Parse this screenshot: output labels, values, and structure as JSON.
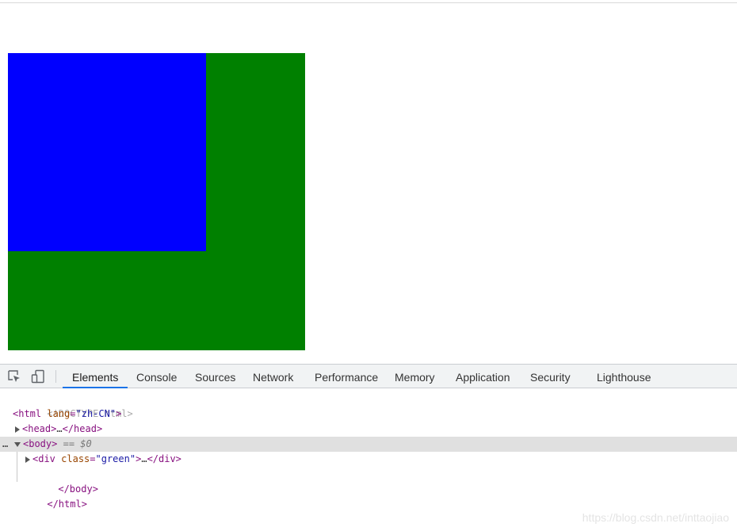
{
  "devtools": {
    "tabs": [
      "Elements",
      "Console",
      "Sources",
      "Network",
      "Performance",
      "Memory",
      "Application",
      "Security",
      "Lighthouse"
    ],
    "active_tab": "Elements",
    "icons": [
      "inspect-element-icon",
      "device-toolbar-icon"
    ]
  },
  "dom": {
    "doctype": "<!DOCTYPE html>",
    "html_open_tag": "<html",
    "html_attr_name": "lang",
    "html_attr_value": "zh-CN",
    "head_open": "<head>",
    "head_ellipsis": "…",
    "head_close": "</head>",
    "body_open": "<body>",
    "body_marker": "== $0",
    "div_open_tag": "<div",
    "div_attr_name": "class",
    "div_attr_value": "green",
    "div_ellipsis": "…",
    "div_close": "</div>",
    "body_close": "</body>",
    "html_close": "</html>",
    "dots": "…"
  },
  "page": {
    "outer_color": "#008000",
    "inner_color": "#0000ff"
  },
  "watermark": "https://blog.csdn.net/inttaojiao"
}
